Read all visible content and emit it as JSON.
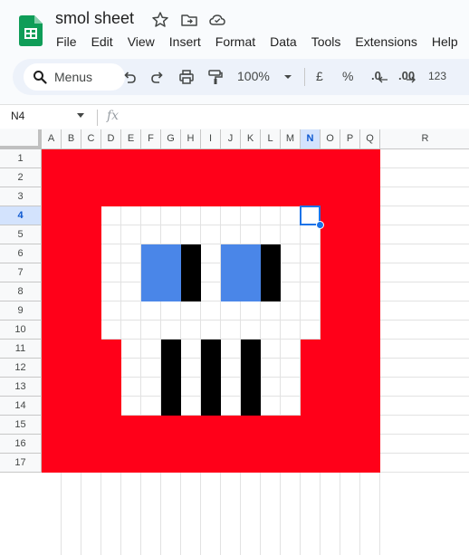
{
  "app": {
    "doc_title": "smol sheet",
    "brand_color": "#0f9d58"
  },
  "menu": {
    "items": [
      "File",
      "Edit",
      "View",
      "Insert",
      "Format",
      "Data",
      "Tools",
      "Extensions",
      "Help"
    ]
  },
  "toolbar": {
    "search_label": "Menus",
    "zoom": "100%",
    "currency": "£",
    "percent": "%",
    "decrease_decimal": ".0",
    "increase_decimal": ".00",
    "number_format": "123"
  },
  "formula_bar": {
    "name_box": "N4",
    "fx": "fx",
    "value": ""
  },
  "sheet": {
    "columns": [
      "A",
      "B",
      "C",
      "D",
      "E",
      "F",
      "G",
      "H",
      "I",
      "J",
      "K",
      "L",
      "M",
      "N",
      "O",
      "P",
      "Q",
      "R"
    ],
    "rows": [
      "1",
      "2",
      "3",
      "4",
      "5",
      "6",
      "7",
      "8",
      "9",
      "10",
      "11",
      "12",
      "13",
      "14",
      "15",
      "16",
      "17"
    ],
    "active_column": "N",
    "active_row": "4",
    "palette": {
      "r": "#ff0019",
      "w": "#ffffff",
      "b": "#4a86e8",
      "k": "#000000"
    },
    "pixel_rows": [
      "rrrrrrrrrrrrrrrrr",
      "rrrrrrrrrrrrrrrrr",
      "rrrrrrrrrrrrrrrrr",
      "rrrwwwwwwwwwwwrrr",
      "rrrwwwwwwwwwwwrrr",
      "rrrwwbbkwbbkwwrrr",
      "rrrwwbbkwbbkwwrrr",
      "rrrwwbbkwbbkwwrrr",
      "rrrwwwwwwwwwwwrrr",
      "rrrwwwwwwwwwwwrrr",
      "rrrrwwkwkwkwwrrrr",
      "rrrrwwkwkwkwwrrrr",
      "rrrrwwkwkwkwwrrrr",
      "rrrrwwkwkwkwwrrrr",
      "rrrrrrrrrrrrrrrrr",
      "rrrrrrrrrrrrrrrrr",
      "rrrrrrrrrrrrrrrrr"
    ]
  }
}
